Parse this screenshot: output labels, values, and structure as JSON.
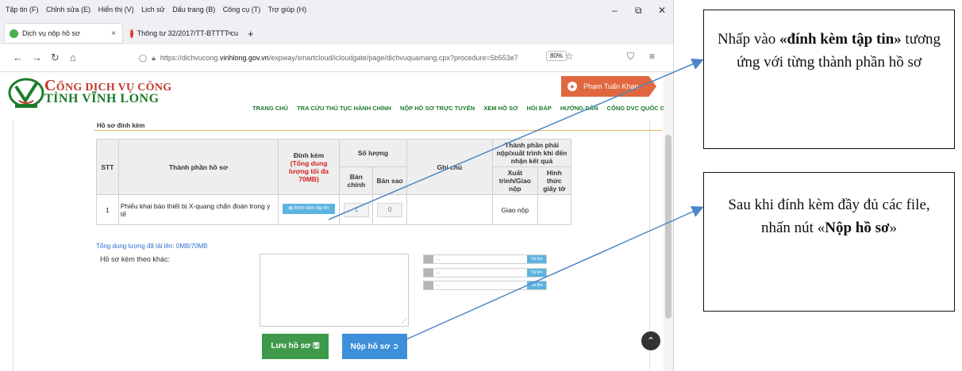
{
  "browser": {
    "menu": [
      "Tập tin (F)",
      "Chỉnh sửa (E)",
      "Hiển thị (V)",
      "Lịch sử",
      "Dấu trang (B)",
      "Công cụ (T)",
      "Trợ giúp (H)"
    ],
    "tabs": [
      {
        "label": "Dịch vụ nộp hồ sơ",
        "close": "×"
      },
      {
        "label": "Thông tư 32/2017/TT-BTTTT cu",
        "close": "×"
      }
    ],
    "new_tab": "+",
    "url_prefix": "https://dichvucong.",
    "url_domain": "vinhlong.gov.vn",
    "url_suffix": "/expway/smartcloud/icloudgate/page/dichvuquamang.cpx?procedure=5b553e7",
    "zoom": "80%"
  },
  "site": {
    "logo_line1_big": "C",
    "logo_line1_rest": "ỔNG DỊCH VỤ CÔNG",
    "logo_line2": "TỈNH VĨNH LONG",
    "user_name": "Phạm Tuấn Khan",
    "nav": [
      "TRANG CHỦ",
      "TRA CỨU THỦ TỤC HÀNH CHÍNH",
      "NỘP HỒ SƠ TRỰC TUYẾN",
      "XEM HỒ SƠ",
      "HỎI ĐÁP",
      "HƯỚNG DẪN",
      "CỔNG DVC QUỐC GIA"
    ]
  },
  "section": {
    "title": "Hồ sơ đính kèm",
    "headers": {
      "stt": "STT",
      "component": "Thành phần hồ sơ",
      "attach": "Đính kèm",
      "attach_note": "(Tổng dung lượng tối đa 70MB)",
      "quantity": "Số lượng",
      "original": "Bản chính",
      "copy": "Bản sao",
      "note": "Ghi chú",
      "submit_group": "Thành phần phải nộp/xuất trình khi đến nhận kết quả",
      "present": "Xuất trình/Giao nộp",
      "form": "Hình thức giấy tờ"
    },
    "rows": [
      {
        "stt": "1",
        "component": "Phiếu khai báo thiết bị X-quang chẩn đoán trong y tế",
        "attach_button": "Đính kèm tệp tin",
        "original": "1",
        "copy": "0",
        "note": "",
        "present": "Giao nộp",
        "form": ""
      }
    ],
    "total_uploaded": "Tổng dung lượng đã tải lên: 0MB/70MB",
    "other_label": "Hồ sơ kèm theo khác:",
    "file_rows": [
      {
        "name": "...",
        "upload": "Tải lên"
      },
      {
        "name": "...",
        "upload": "Tải lên"
      },
      {
        "name": "...",
        "upload": "Tải lên"
      }
    ],
    "save_button": "Lưu hồ sơ 🖫",
    "submit_button": "Nộp hồ sơ ➲"
  },
  "callouts": {
    "c1_pre": "Nhấp vào ",
    "c1_bold": "«đính kèm tập tin»",
    "c1_post": " tương ứng với từng thành phần hồ sơ",
    "c2_pre": "Sau khi đính kèm đầy đủ các file, nhấn nút «",
    "c2_bold": "Nộp hồ sơ",
    "c2_post": "»"
  },
  "colors": {
    "brand_green": "#1d7a2c",
    "brand_red": "#c0392b",
    "accent_blue": "#3d8fd9",
    "save_green": "#3e9a4a",
    "arrow": "#4f86c6"
  }
}
